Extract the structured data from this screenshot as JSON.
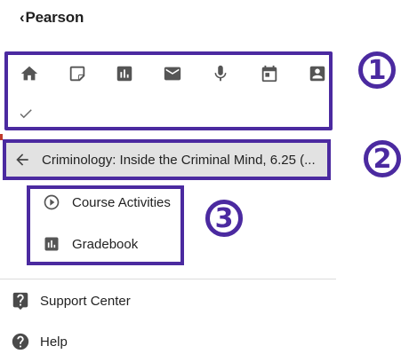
{
  "brand": {
    "logo_text": "Pearson",
    "logo_mark": "‹"
  },
  "nav_icons": [
    {
      "name": "home-icon"
    },
    {
      "name": "note-icon"
    },
    {
      "name": "chart-icon"
    },
    {
      "name": "mail-icon"
    },
    {
      "name": "microphone-icon"
    },
    {
      "name": "calendar-icon"
    },
    {
      "name": "contact-icon"
    }
  ],
  "check_icon": "check-icon",
  "badges": {
    "one": "1",
    "two": "2",
    "three": "3"
  },
  "course": {
    "back_icon": "arrow-left-icon",
    "title": "Criminology: Inside the Criminal Mind, 6.25 (..."
  },
  "submenu": [
    {
      "label": "Course Activities",
      "icon": "play-circle-icon"
    },
    {
      "label": "Gradebook",
      "icon": "gradebook-icon"
    }
  ],
  "footer": [
    {
      "label": "Support Center",
      "icon": "help-square-icon"
    },
    {
      "label": "Help",
      "icon": "help-circle-icon"
    }
  ],
  "colors": {
    "accent": "#4b2aa0",
    "course_bar_bg": "#e2e2e2"
  }
}
